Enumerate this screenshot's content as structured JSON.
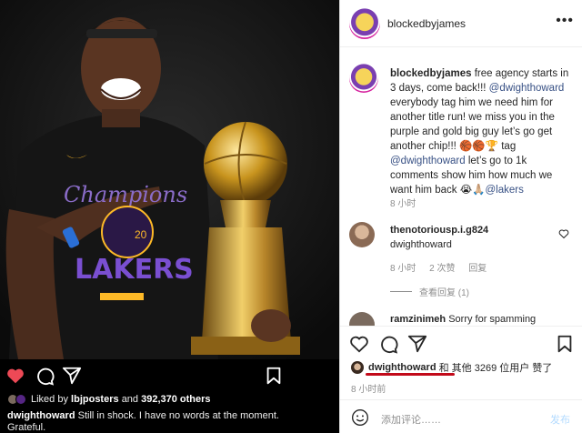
{
  "left": {
    "likes": {
      "prefix": "Liked by",
      "user": "lbjposters",
      "and": "and",
      "count": "392,370 others"
    },
    "caption": {
      "user": "dwighthoward",
      "text": "Still in shock.  I have no words at the moment. Grateful."
    },
    "shirt": {
      "champions": "Champions",
      "year": "20",
      "team": "LAKERS"
    }
  },
  "post": {
    "username": "blockedbyjames",
    "more_icon": "•••",
    "caption": {
      "user": "blockedbyjames",
      "part1": "free agency starts in 3 days, come back!!!",
      "mention1": "@dwighthoward",
      "part2": "everybody tag him we need him for another title run! we miss you in the purple and gold big guy let’s go get another chip!!! 🏀🏀🏆 tag",
      "mention2": "@dwighthoward",
      "part3": "let’s go to 1k comments show him how much we want him back 😭🙏🏼",
      "mention3": "@lakers"
    },
    "time": "8 小时"
  },
  "comment": {
    "user": "thenotoriousp.i.g824",
    "text": "dwighthoward",
    "time": "8 小时",
    "likes": "2 次赞",
    "reply": "回复",
    "view_replies": "查看回复 (1)"
  },
  "comment2": {
    "user": "ramzinimeh",
    "text": "Sorry for spamming"
  },
  "actions": {
    "likes_user": "dwighthoward",
    "likes_rest": "和 其他 3269 位用户 赞了",
    "time": "8 小时前"
  },
  "comment_box": {
    "placeholder": "添加评论……",
    "post": "发布"
  },
  "colors": {
    "like_red": "#ed4956",
    "link": "#385185",
    "underline": "#c20a1a",
    "lakers_purple": "#552583",
    "lakers_gold": "#fdb927"
  },
  "icons": [
    "heart-icon",
    "comment-icon",
    "share-icon",
    "bookmark-icon",
    "smile-icon",
    "more-icon"
  ]
}
